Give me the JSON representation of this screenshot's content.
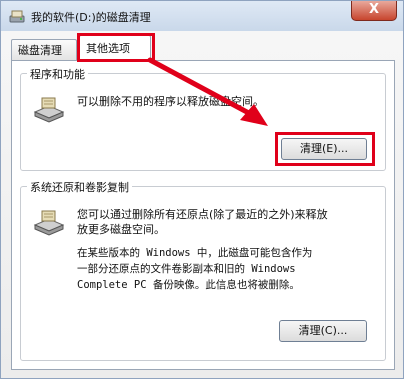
{
  "window": {
    "title": "我的软件(D:)的磁盘清理",
    "close_glyph": "X"
  },
  "tabs": [
    {
      "label": "磁盘清理",
      "active": false
    },
    {
      "label": "其他选项",
      "active": true
    }
  ],
  "programs_group": {
    "title": "程序和功能",
    "description": "可以删除不用的程序以释放磁盘空间。",
    "button_label": "清理(E)..."
  },
  "restore_group": {
    "title": "系统还原和卷影复制",
    "description_lines": [
      "您可以通过删除所有还原点(除了最近的之外)来释放",
      "放更多磁盘空间。"
    ],
    "note_lines": [
      "在某些版本的 Windows 中，此磁盘可能包含作为",
      "一部分还原点的文件卷影副本和旧的 Windows",
      "Complete PC 备份映像。此信息也将被删除。"
    ],
    "button_label": "清理(C)..."
  },
  "colors": {
    "highlight": "#e0001a",
    "arrow": "#e0001a"
  },
  "icons": {
    "app": "disk-cleanup-icon",
    "programs": "drive-cleanup-icon",
    "restore": "drive-cleanup-icon",
    "close": "close-icon"
  }
}
